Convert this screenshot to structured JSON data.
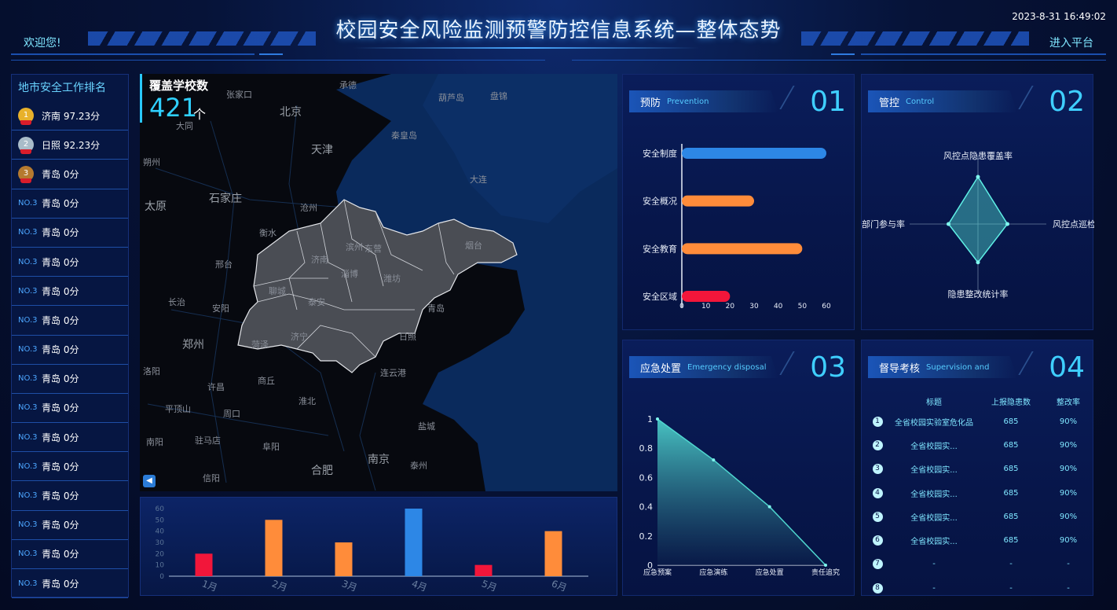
{
  "header": {
    "title": "校园安全风险监测预警防控信息系统—整体态势",
    "welcome": "欢迎您!",
    "enter": "进入平台",
    "datetime": "2023-8-31 16:49:02"
  },
  "ranking": {
    "title": "地市安全工作排名",
    "items": [
      {
        "badge": "1",
        "type": "gold",
        "label": "济南 97.23分"
      },
      {
        "badge": "2",
        "type": "silver",
        "label": "日照 92.23分"
      },
      {
        "badge": "3",
        "type": "bronze",
        "label": "青岛 0分"
      },
      {
        "badge": "NO.3",
        "type": "no",
        "label": "青岛 0分"
      },
      {
        "badge": "NO.3",
        "type": "no",
        "label": "青岛 0分"
      },
      {
        "badge": "NO.3",
        "type": "no",
        "label": "青岛 0分"
      },
      {
        "badge": "NO.3",
        "type": "no",
        "label": "青岛 0分"
      },
      {
        "badge": "NO.3",
        "type": "no",
        "label": "青岛 0分"
      },
      {
        "badge": "NO.3",
        "type": "no",
        "label": "青岛 0分"
      },
      {
        "badge": "NO.3",
        "type": "no",
        "label": "青岛 0分"
      },
      {
        "badge": "NO.3",
        "type": "no",
        "label": "青岛 0分"
      },
      {
        "badge": "NO.3",
        "type": "no",
        "label": "青岛 0分"
      },
      {
        "badge": "NO.3",
        "type": "no",
        "label": "青岛 0分"
      },
      {
        "badge": "NO.3",
        "type": "no",
        "label": "青岛 0分"
      },
      {
        "badge": "NO.3",
        "type": "no",
        "label": "青岛 0分"
      },
      {
        "badge": "NO.3",
        "type": "no",
        "label": "青岛 0分"
      },
      {
        "badge": "NO.3",
        "type": "no",
        "label": "青岛 0分"
      }
    ]
  },
  "map": {
    "cover_label": "覆盖学校数",
    "cover_value": "421",
    "cover_unit": "个",
    "cities": [
      "承德",
      "张家口",
      "葫芦岛",
      "盘锦",
      "北京",
      "大同",
      "秦皇岛",
      "天津",
      "朔州",
      "大连",
      "太原",
      "石家庄",
      "沧州",
      "衡水",
      "烟台",
      "济南",
      "潍坊",
      "淄博",
      "滨州",
      "东营",
      "邢台",
      "聊城",
      "泰安",
      "长治",
      "安阳",
      "青岛",
      "郑州",
      "菏泽",
      "济宁",
      "日照",
      "连云港",
      "洛阳",
      "许昌",
      "商丘",
      "淮北",
      "平顶山",
      "周口",
      "盐城",
      "南阳",
      "驻马店",
      "阜阳",
      "合肥",
      "南京",
      "泰州",
      "信阳"
    ]
  },
  "panels": {
    "prevention": {
      "cn": "预防",
      "en": "Prevention",
      "num": "01"
    },
    "control": {
      "cn": "管控",
      "en": "Control",
      "num": "02"
    },
    "emergency": {
      "cn": "应急处置",
      "en": "Emergency disposal",
      "num": "03"
    },
    "supervision": {
      "cn": "督导考核",
      "en": "Supervision and",
      "num": "04"
    }
  },
  "colors": {
    "blue": "#2d87e6",
    "orange": "#ff8c3a",
    "red": "#f2163a",
    "cyan": "#3fcfff",
    "teal": "#4fd6cf"
  },
  "chart_data": [
    {
      "id": "monthly",
      "type": "bar",
      "categories": [
        "1月",
        "2月",
        "3月",
        "4月",
        "5月",
        "6月"
      ],
      "values": [
        20,
        50,
        30,
        60,
        10,
        40
      ],
      "bar_colors": [
        "#f2163a",
        "#ff8c3a",
        "#ff8c3a",
        "#2d87e6",
        "#f2163a",
        "#ff8c3a"
      ],
      "ylim": [
        0,
        60
      ],
      "yticks": [
        0,
        10,
        20,
        30,
        40,
        50,
        60
      ]
    },
    {
      "id": "prevention",
      "type": "bar",
      "orientation": "horizontal",
      "categories": [
        "安全制度",
        "安全概况",
        "安全教育",
        "安全区域"
      ],
      "values": [
        60,
        30,
        50,
        20
      ],
      "bar_colors": [
        "#2d87e6",
        "#ff8c3a",
        "#ff8c3a",
        "#f2163a"
      ],
      "xlim": [
        0,
        60
      ],
      "xticks": [
        0,
        10,
        20,
        30,
        40,
        50,
        60
      ]
    },
    {
      "id": "control",
      "type": "radar",
      "axes": [
        "风控点隐患覆盖率",
        "风控点巡检率",
        "隐患整改统计率",
        "部门参与率"
      ],
      "values": [
        0.8,
        0.5,
        0.65,
        0.5
      ]
    },
    {
      "id": "emergency",
      "type": "area",
      "categories": [
        "应急预案",
        "应急演练",
        "应急处置",
        "责任追究"
      ],
      "values": [
        1,
        0.72,
        0.4,
        0
      ],
      "ylim": [
        0,
        1
      ],
      "yticks": [
        "0",
        "0.2",
        "0.4",
        "0.6",
        "0.8",
        "1"
      ]
    },
    {
      "id": "supervision",
      "type": "table",
      "headers": [
        "标题",
        "上报隐患数",
        "整改率"
      ],
      "rows": [
        [
          "1",
          "全省校园实验室危化品",
          "685",
          "90%"
        ],
        [
          "2",
          "全省校园实...",
          "685",
          "90%"
        ],
        [
          "3",
          "全省校园实...",
          "685",
          "90%"
        ],
        [
          "4",
          "全省校园实...",
          "685",
          "90%"
        ],
        [
          "5",
          "全省校园实...",
          "685",
          "90%"
        ],
        [
          "6",
          "全省校园实...",
          "685",
          "90%"
        ],
        [
          "7",
          "-",
          "-",
          "-"
        ],
        [
          "8",
          "-",
          "-",
          "-"
        ]
      ]
    }
  ]
}
